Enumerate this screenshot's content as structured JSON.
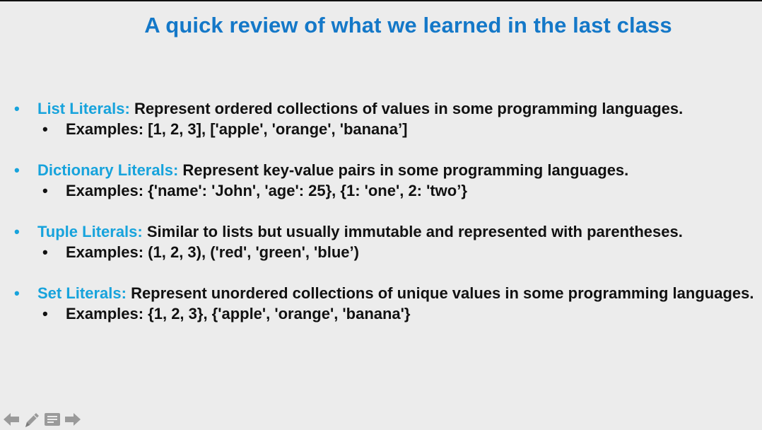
{
  "slide": {
    "title": "A quick review of what we learned in the last class",
    "items": [
      {
        "term": "List Literals:",
        "text": "Represent ordered collections of values in some programming languages.",
        "example": "Examples: [1, 2, 3], ['apple', 'orange', 'banana’]"
      },
      {
        "term": "Dictionary Literals:",
        "text": "Represent key-value pairs in some programming languages.",
        "example": "Examples: {'name': 'John', 'age': 25}, {1: 'one', 2: 'two’}"
      },
      {
        "term": "Tuple Literals:",
        "text": "Similar to lists but usually immutable and represented with parentheses.",
        "example": "Examples: (1, 2, 3), ('red', 'green', 'blue’)"
      },
      {
        "term": "Set Literals:",
        "text": "Represent unordered collections of unique values in some programming languages.",
        "example": "Examples: {1, 2, 3}, {'apple', 'orange', 'banana'}"
      }
    ]
  },
  "nav": {
    "icons": [
      "arrow-left-icon",
      "pen-icon",
      "notes-icon",
      "arrow-right-icon"
    ]
  },
  "colors": {
    "title": "#1478c8",
    "term": "#17a3dc",
    "text": "#111111",
    "background": "#ececec"
  }
}
